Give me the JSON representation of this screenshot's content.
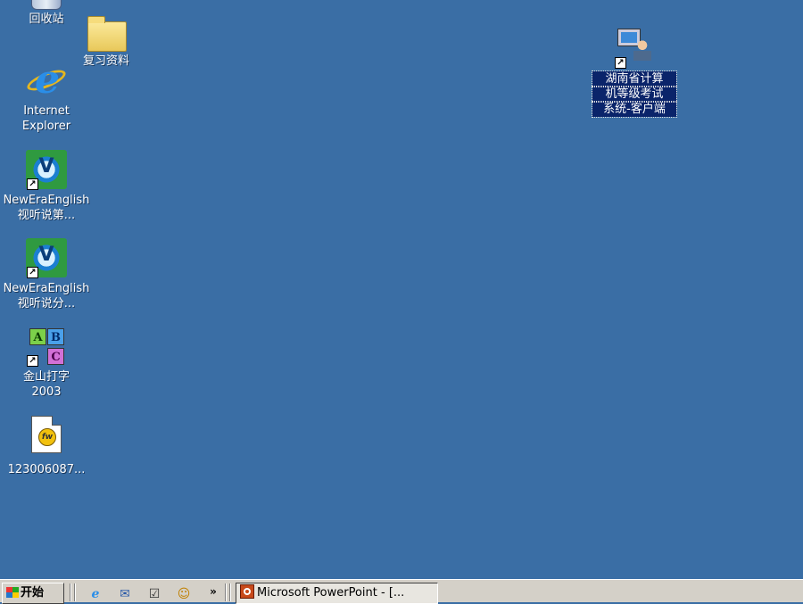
{
  "desktop": {
    "background_color": "#3a6ea5",
    "icons": [
      {
        "label_lines": [
          "回收站"
        ],
        "icon": "recycle-bin-icon",
        "shortcut": false
      },
      {
        "label_lines": [
          "复习资料"
        ],
        "icon": "folder-icon",
        "shortcut": false
      },
      {
        "label_lines": [
          "Internet",
          "Explorer"
        ],
        "icon": "internet-explorer-icon",
        "shortcut": false
      },
      {
        "label_lines": [
          "NewEraEnglish",
          "视听说第..."
        ],
        "icon": "newera-english-icon",
        "shortcut": true
      },
      {
        "label_lines": [
          "NewEraEnglish",
          "视听说分..."
        ],
        "icon": "newera-english-icon",
        "shortcut": true
      },
      {
        "label_lines": [
          "金山打字",
          "2003"
        ],
        "icon": "typing-abc-icon",
        "shortcut": true,
        "blocks": [
          "A",
          "B",
          "C"
        ]
      },
      {
        "label_lines": [
          "123006087..."
        ],
        "icon": "document-icon",
        "shortcut": false,
        "seal_text": "fw"
      },
      {
        "label_lines": [
          "湖南省计算",
          "机等级考试",
          "系统-客户端"
        ],
        "icon": "exam-client-icon",
        "shortcut": true,
        "selected": true
      }
    ],
    "shortcut_arrow": "↗"
  },
  "taskbar": {
    "start_label": "开始",
    "quick_launch": [
      "ie-icon",
      "outlook-icon",
      "desktop-icon",
      "lion-icon"
    ],
    "chevron": "»",
    "tasks": [
      {
        "label": "Microsoft PowerPoint - [...",
        "icon": "powerpoint-icon",
        "active": true
      }
    ]
  }
}
